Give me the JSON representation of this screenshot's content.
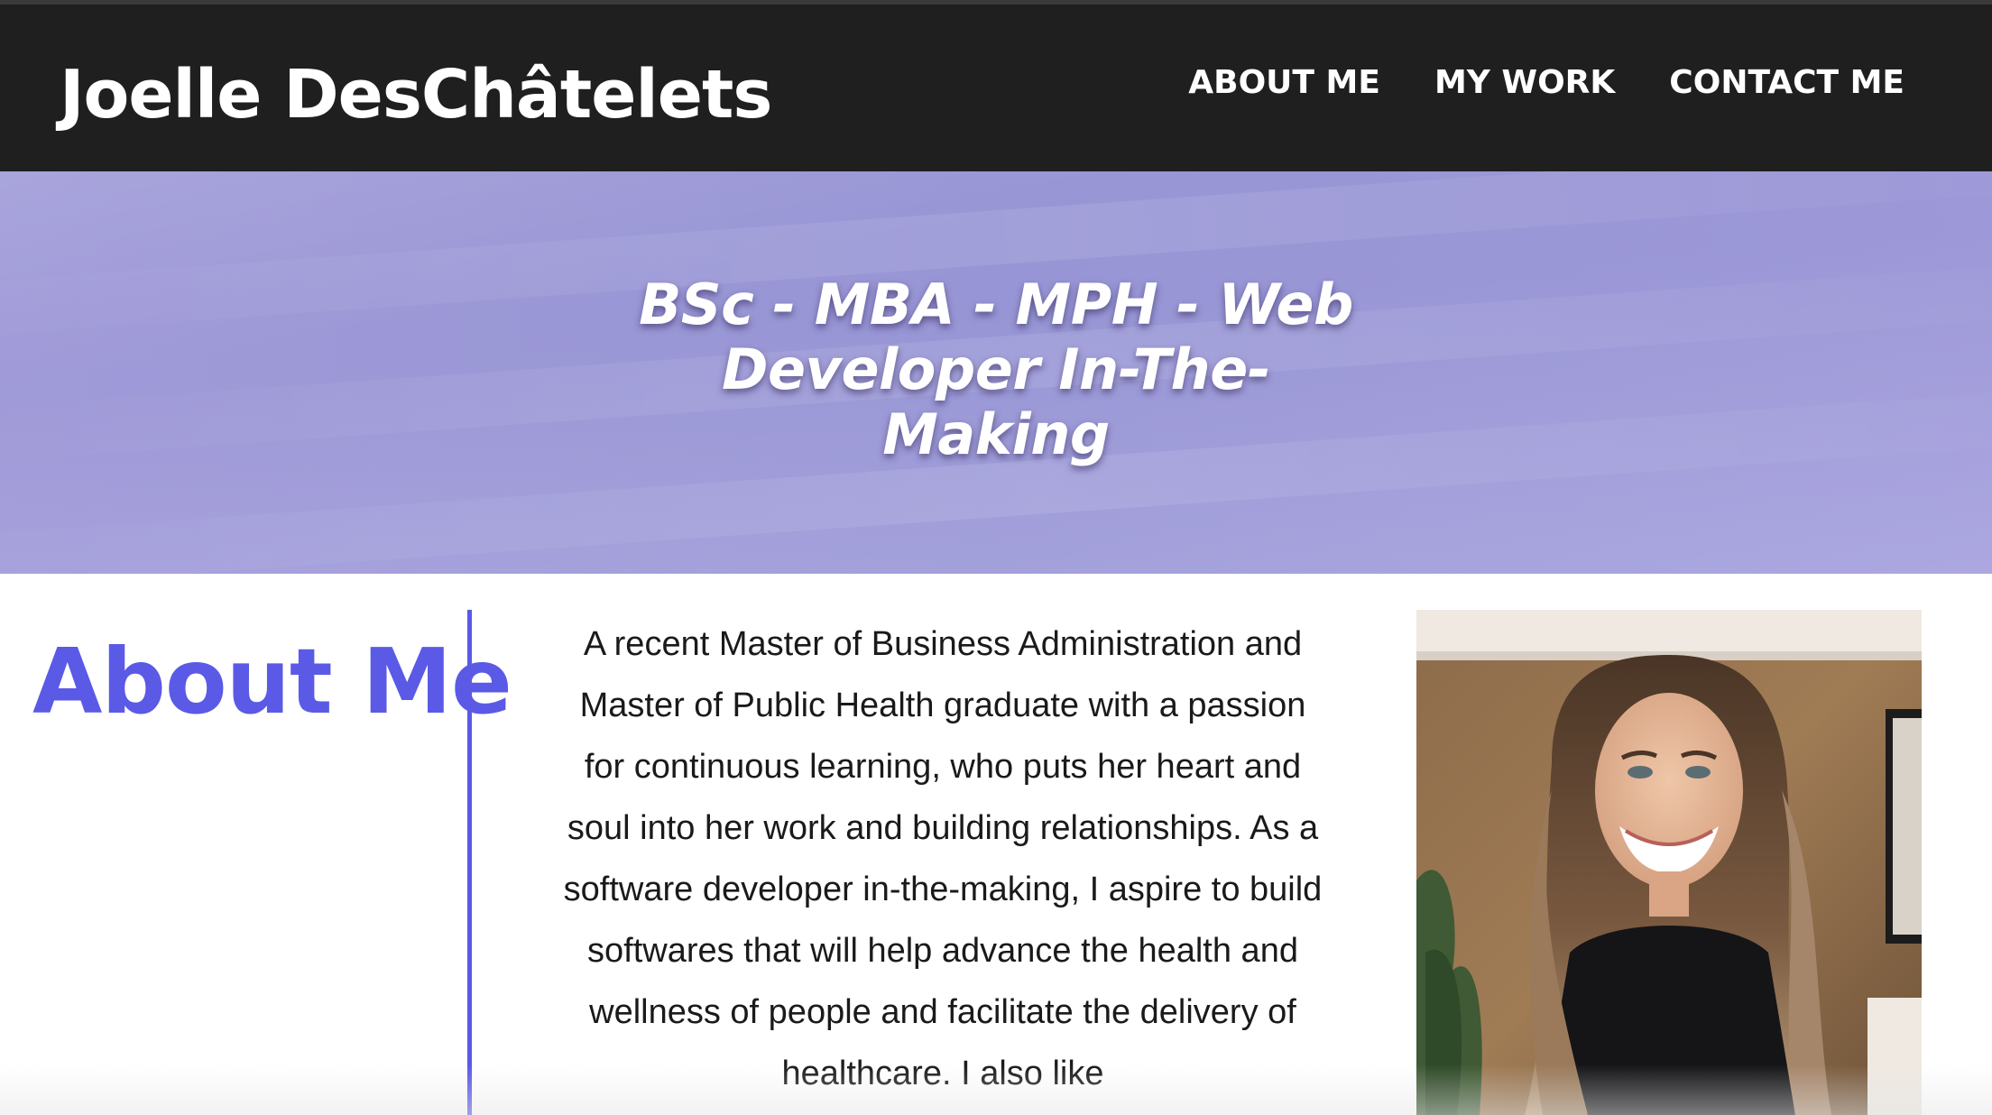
{
  "site": {
    "brand": "Joelle DesChâtelets"
  },
  "nav": {
    "items": [
      {
        "label": "ABOUT ME"
      },
      {
        "label": "MY WORK"
      },
      {
        "label": "CONTACT ME"
      }
    ]
  },
  "hero": {
    "tagline": "BSc - MBA - MPH - Web Developer In-The-Making"
  },
  "about": {
    "heading": "About Me",
    "body": "A recent Master of Business Administration and Master of Public Health graduate with a passion for continuous learning, who puts her heart and soul into her work and building relationships. As a software developer in-the-making, I aspire to build softwares that will help advance the health and wellness of people and facilitate the delivery of healthcare. I also like"
  },
  "colors": {
    "header_bg": "#1f1f1f",
    "accent": "#5a5ae6",
    "hero_bg": "#a3a1da"
  }
}
